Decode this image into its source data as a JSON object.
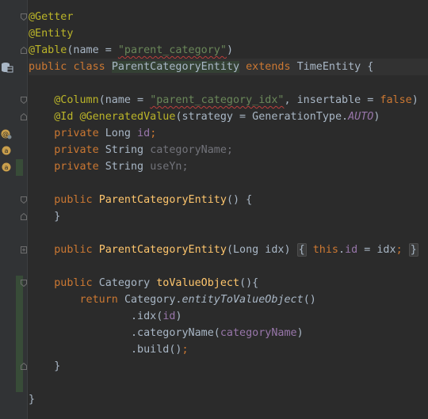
{
  "editor": {
    "lines": {
      "l1_getter": "@Getter",
      "l2_entity": "@Entity",
      "l3_table_ann": "@Table",
      "l3_open": "(name = ",
      "l3_value": "\"parent_category\"",
      "l3_close": ")",
      "l4_public": "public",
      "l4_class": "class",
      "l4_name": "ParentCategoryEntity",
      "l4_extends": "extends",
      "l4_parent": "TimeEntity {",
      "l6_column_ann": "@Column",
      "l6_open": "(name = ",
      "l6_value": "\"parent_category_idx\"",
      "l6_mid": ", insertable = ",
      "l6_false": "false",
      "l6_close": ")",
      "l7_id_ann": "@Id",
      "l7_gen_ann": "@GeneratedValue",
      "l7_open": "(strategy = GenerationType.",
      "l7_auto": "AUTO",
      "l7_close": ")",
      "l8_private": "private",
      "l8_type": "Long",
      "l8_field": "id",
      "l8_semi": ";",
      "l9_private": "private",
      "l9_type": "String",
      "l9_field": "categoryName;",
      "l10_private": "private",
      "l10_type": "String",
      "l10_field": "useYn;",
      "l12_public": "public",
      "l12_ctor": "ParentCategoryEntity",
      "l12_rest": "() {",
      "l13_brace": "}",
      "l15_public": "public",
      "l15_ctor": "ParentCategoryEntity",
      "l15_params": "(Long idx)",
      "l15_fold_open": "{",
      "l15_this": "this",
      "l15_dot": ".",
      "l15_field": "id",
      "l15_assign": " = idx",
      "l15_semi": ";",
      "l15_fold_close": "}",
      "l17_public": "public",
      "l17_type": "Category",
      "l17_method": "toValueObject",
      "l17_rest": "(){",
      "l18_return": "return",
      "l18_class": "Category.",
      "l18_static": "entityToValueObject",
      "l18_rest": "()",
      "l19_call": ".idx(",
      "l19_arg": "id",
      "l19_close": ")",
      "l20_call": ".categoryName(",
      "l20_arg": "categoryName",
      "l20_close": ")",
      "l21_call": ".build()",
      "l21_semi": ";",
      "l22_brace": "}",
      "l24_brace": "}"
    },
    "gutter_icons": [
      "database-icon",
      "field-annotation-icon",
      "field-annotation-icon",
      "field-annotation-icon"
    ]
  }
}
